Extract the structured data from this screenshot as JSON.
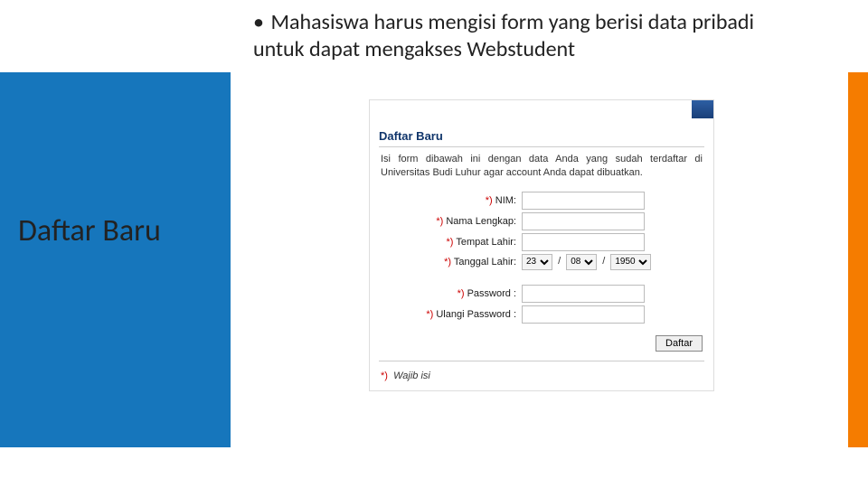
{
  "sidebar": {
    "title": "Daftar Baru"
  },
  "bullet": {
    "text": "Mahasiswa harus mengisi form yang berisi data pribadi untuk dapat mengakses Webstudent"
  },
  "form": {
    "heading": "Daftar Baru",
    "intro": "Isi form dibawah ini dengan data Anda yang sudah terdaftar di Universitas Budi Luhur agar account Anda dapat dibuatkan.",
    "req_mark": "*)",
    "labels": {
      "nim": "NIM:",
      "nama": "Nama Lengkap:",
      "tempat": "Tempat Lahir:",
      "tanggal": "Tanggal Lahir:",
      "password": "Password :",
      "password2": "Ulangi Password :"
    },
    "date": {
      "day": "23",
      "month": "08",
      "year": "1950",
      "sep": "/"
    },
    "button": "Daftar",
    "footnote": "Wajib isi"
  }
}
